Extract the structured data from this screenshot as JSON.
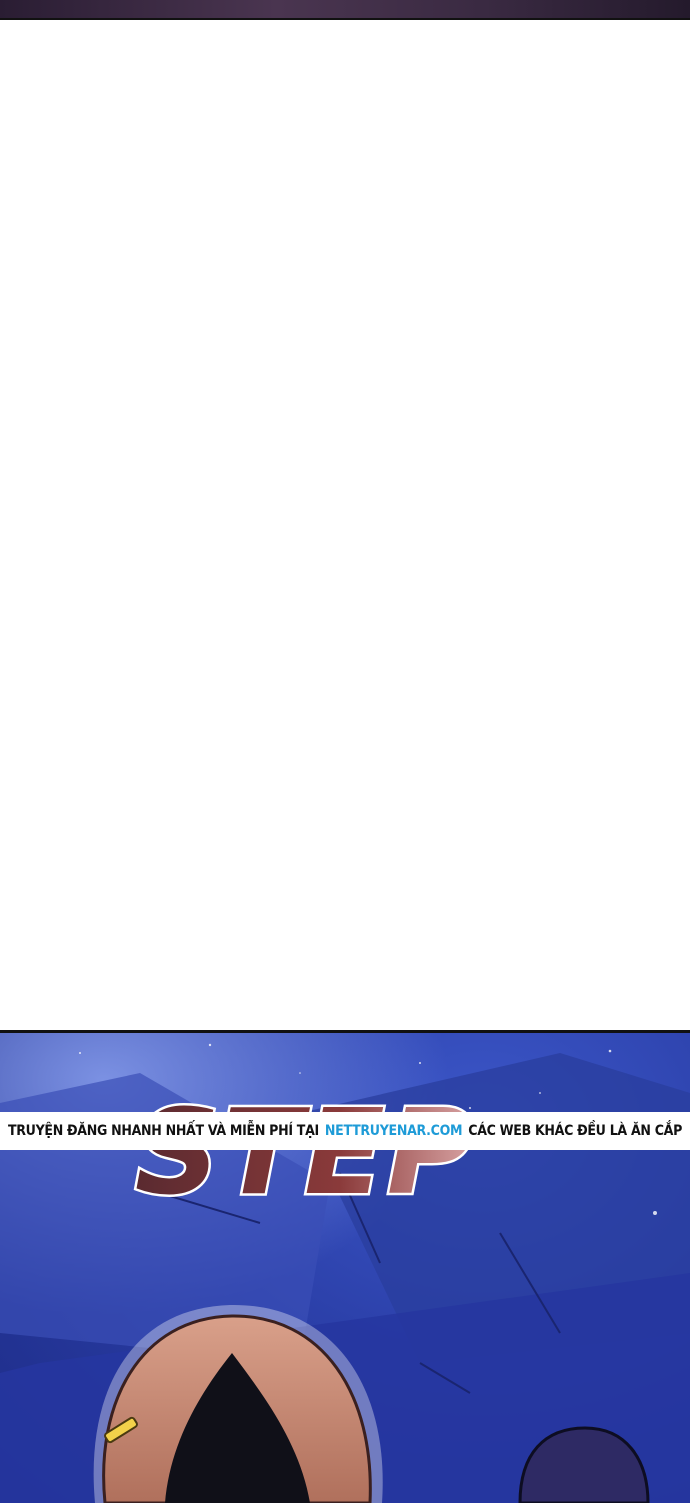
{
  "comic": {
    "sfx_text": "STEP",
    "banner": {
      "prefix": "TRUYỆN ĐĂNG NHANH NHẤT VÀ MIỄN PHÍ TẠI",
      "site": "NETTRUYENAR.COM",
      "suffix": "CÁC WEB KHÁC ĐỀU LÀ ĂN CẮP"
    },
    "colors": {
      "night_sky": "#2b3fa8",
      "hair": "#c98a74",
      "sfx_fill": "#8a3a3a",
      "banner_site": "#1e9bd7"
    }
  }
}
